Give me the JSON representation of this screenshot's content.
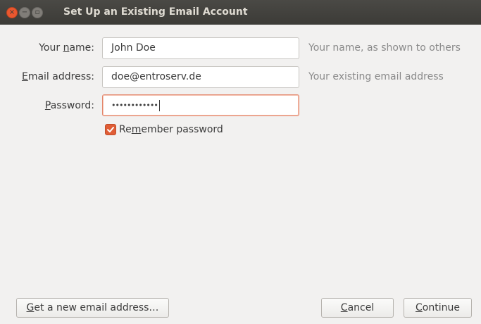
{
  "window": {
    "title": "Set Up an Existing Email Account",
    "controls": {
      "close_glyph": "×",
      "min_glyph": "−",
      "max_glyph": "▫"
    }
  },
  "form": {
    "name": {
      "label_pre": "Your ",
      "label_mnemonic": "n",
      "label_post": "ame:",
      "value": "John Doe",
      "hint": "Your name, as shown to others"
    },
    "email": {
      "label_pre": "",
      "label_mnemonic": "E",
      "label_post": "mail address:",
      "value": "doe@entroserv.de",
      "hint": "Your existing email address"
    },
    "password": {
      "label_pre": "",
      "label_mnemonic": "P",
      "label_post": "assword:",
      "value": "••••••••••••"
    },
    "remember": {
      "label_pre": "Re",
      "label_mnemonic": "m",
      "label_post": "ember password",
      "checked": true
    }
  },
  "buttons": {
    "new_address": {
      "pre": "",
      "mnemonic": "G",
      "post": "et a new email address…"
    },
    "cancel": {
      "pre": "",
      "mnemonic": "C",
      "post": "ancel"
    },
    "continue": {
      "pre": "",
      "mnemonic": "C",
      "post": "ontinue"
    }
  },
  "colors": {
    "accent": "#e05d36",
    "titlebar": "#3c3b37",
    "hint": "#8a8a8a"
  }
}
